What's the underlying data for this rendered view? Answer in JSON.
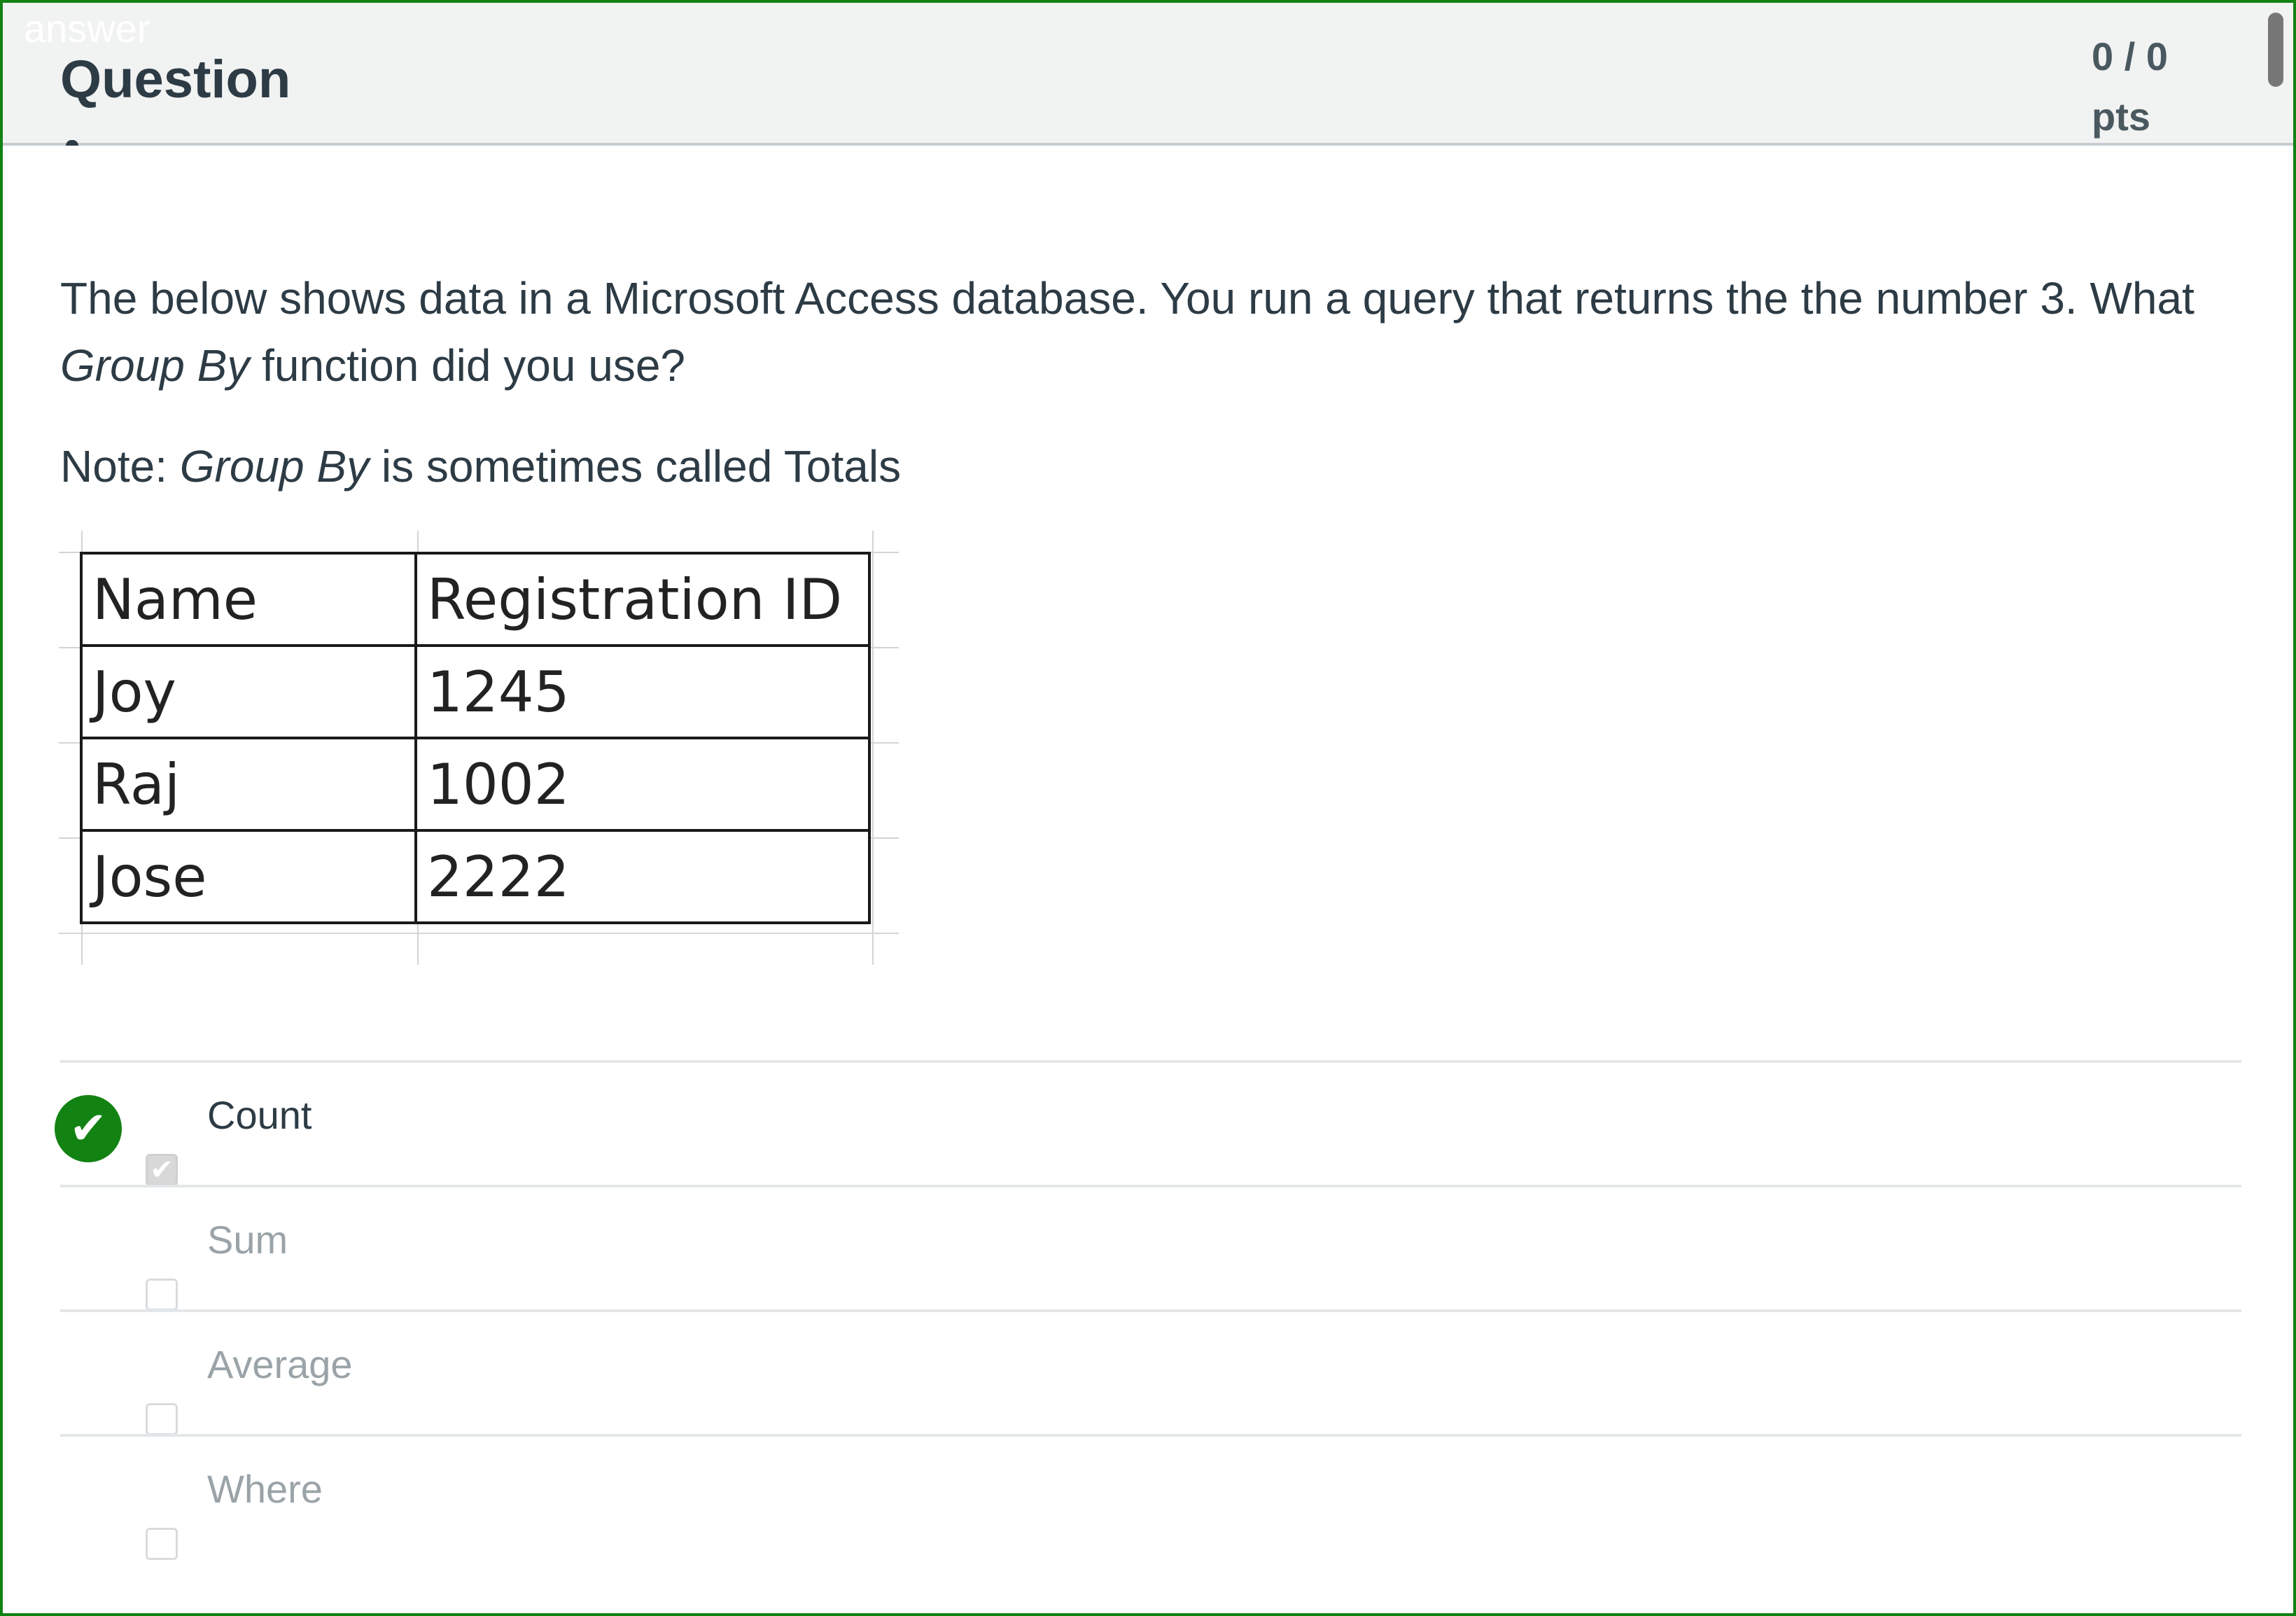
{
  "header": {
    "overlay_label": "answer",
    "title": "Question",
    "points_value": "0 / 0",
    "points_unit": "pts"
  },
  "question": {
    "text_before": "The below shows data in a Microsoft Access database. You run a query that returns the the number 3. What ",
    "text_italic": "Group By",
    "text_after": " function did you use?",
    "note_prefix": "Note: ",
    "note_italic": "Group By",
    "note_suffix": " is sometimes called Totals"
  },
  "table": {
    "headers": [
      "Name",
      "Registration ID"
    ],
    "rows": [
      [
        "Joy",
        "1245"
      ],
      [
        "Raj",
        "1002"
      ],
      [
        "Jose",
        "2222"
      ]
    ]
  },
  "answers": [
    {
      "label": "Count",
      "checked": true,
      "correct": true
    },
    {
      "label": "Sum",
      "checked": false,
      "correct": false
    },
    {
      "label": "Average",
      "checked": false,
      "correct": false
    },
    {
      "label": "Where",
      "checked": false,
      "correct": false
    }
  ],
  "icons": {
    "correct": "check-circle-icon",
    "checkbox_checked": "checkmark-icon"
  },
  "colors": {
    "correct_green": "#128212",
    "header_bg": "#f1f2f2",
    "text_primary": "#2d3b45",
    "text_muted": "#9aa3a8"
  }
}
